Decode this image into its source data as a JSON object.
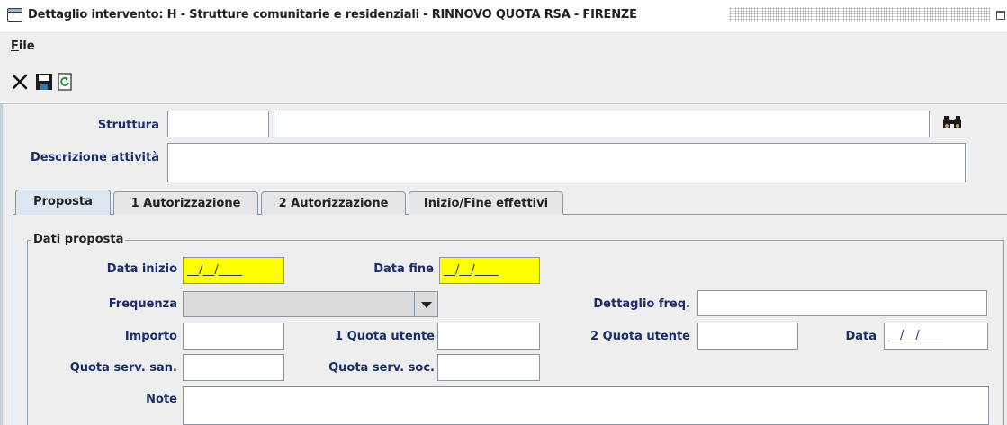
{
  "window": {
    "title": "Dettaglio intervento: H - Strutture comunitarie e residenziali - RINNOVO QUOTA RSA - FIRENZE"
  },
  "menu": {
    "file_label": "File",
    "file_mnemonic": "F",
    "file_rest": "ile"
  },
  "toolbar": {
    "icons": [
      "close-icon",
      "save-icon",
      "refresh-icon"
    ]
  },
  "form": {
    "struttura_label": "Struttura",
    "struttura_code": "",
    "struttura_name": "",
    "descrizione_label": "Descrizione attività",
    "descrizione_value": ""
  },
  "tabs": [
    {
      "label": "Proposta"
    },
    {
      "label": "1 Autorizzazione"
    },
    {
      "label": "2 Autorizzazione"
    },
    {
      "label": "Inizio/Fine effettivi"
    }
  ],
  "proposta": {
    "group_title": "Dati proposta",
    "data_inizio_label": "Data inizio",
    "data_inizio_value": "__/__/____",
    "data_fine_label": "Data fine",
    "data_fine_value": "__/__/____",
    "frequenza_label": "Frequenza",
    "frequenza_value": "",
    "dettaglio_freq_label": "Dettaglio freq.",
    "dettaglio_freq_value": "",
    "importo_label": "Importo",
    "importo_value": "",
    "quota1_label": "1 Quota utente",
    "quota1_value": "",
    "quota2_label": "2 Quota utente",
    "quota2_value": "",
    "data_label": "Data",
    "data_value": "__/__/____",
    "quota_san_label": "Quota serv. san.",
    "quota_san_value": "",
    "quota_soc_label": "Quota serv. soc.",
    "quota_soc_value": "",
    "note_label": "Note",
    "note_value": ""
  },
  "colors": {
    "label": "#1b2e6b",
    "required_field": "#ffff00",
    "tab_active": "#dde6f1"
  }
}
